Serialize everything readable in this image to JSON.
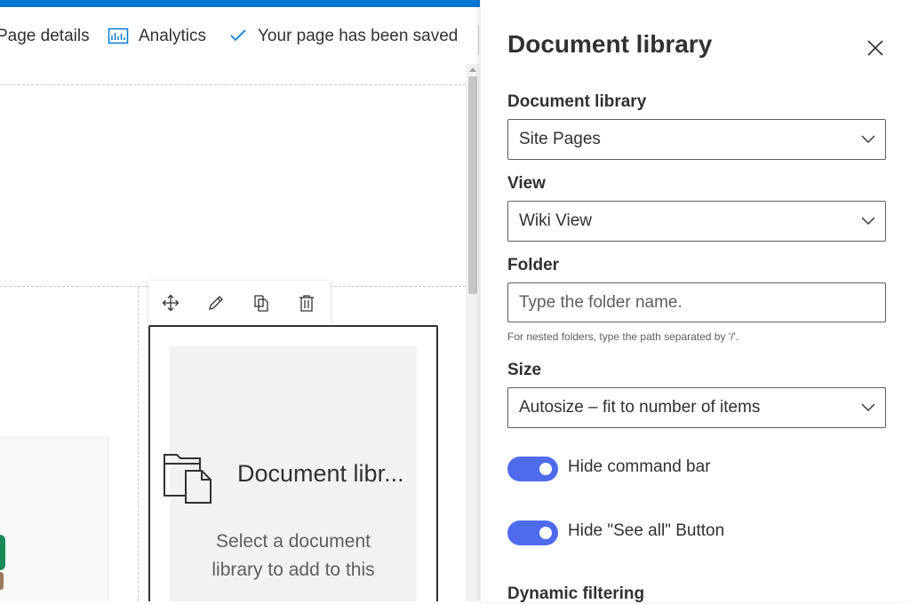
{
  "colors": {
    "accent": "#0078d4",
    "toggle_on": "#4f6bed",
    "placeholder_bg": "#f3f2f1"
  },
  "toolbar": {
    "page_details": "Page details",
    "analytics": "Analytics",
    "saved_status": "Your page has been saved"
  },
  "webpart_toolbar": {
    "icons": [
      "move-icon",
      "edit-icon",
      "duplicate-icon",
      "delete-icon"
    ]
  },
  "webpart": {
    "title": "Document libr...",
    "description": "Select a document library to add to this"
  },
  "panel": {
    "title": "Document library",
    "library": {
      "label": "Document library",
      "value": "Site Pages"
    },
    "view": {
      "label": "View",
      "value": "Wiki View"
    },
    "folder": {
      "label": "Folder",
      "placeholder": "Type the folder name.",
      "value": "",
      "hint": "For nested folders, type the path separated by '/'."
    },
    "size": {
      "label": "Size",
      "value": "Autosize – fit to number of items"
    },
    "hide_command_bar": {
      "label": "Hide command bar",
      "on": true
    },
    "hide_see_all": {
      "label": "Hide \"See all\" Button",
      "on": true
    },
    "dynamic_filtering": {
      "label": "Dynamic filtering"
    }
  }
}
